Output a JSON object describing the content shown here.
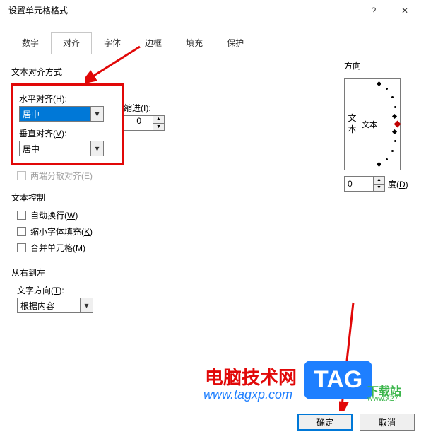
{
  "title": "设置单元格格式",
  "window": {
    "help_icon": "?",
    "close_icon": "✕"
  },
  "tabs": {
    "number": "数字",
    "alignment": "对齐",
    "font": "字体",
    "border": "边框",
    "fill": "填充",
    "protection": "保护"
  },
  "alignment": {
    "text_alignment_label": "文本对齐方式",
    "horizontal_label": "水平对齐(H):",
    "horizontal_value": "居中",
    "vertical_label": "垂直对齐(V):",
    "vertical_value": "居中",
    "indent_label": "缩进(I):",
    "indent_value": "0",
    "justify_distributed": "两端分散对齐(E)"
  },
  "text_control": {
    "label": "文本控制",
    "wrap_text": "自动换行(W)",
    "shrink_to_fit": "缩小字体填充(K)",
    "merge_cells": "合并单元格(M)"
  },
  "rtl": {
    "label": "从右到左",
    "text_direction_label": "文字方向(T):",
    "text_direction_value": "根据内容"
  },
  "orientation": {
    "label": "方向",
    "vertical_text": "文本",
    "dial_text": "文本",
    "degrees_value": "0",
    "degrees_label": "度(D)"
  },
  "buttons": {
    "ok": "确定",
    "cancel": "取消"
  },
  "watermark": {
    "tag": "TAG",
    "text": "电脑技术网",
    "url": "www.tagxp.com",
    "sub": "下载站",
    "suburl": "www.x27"
  }
}
